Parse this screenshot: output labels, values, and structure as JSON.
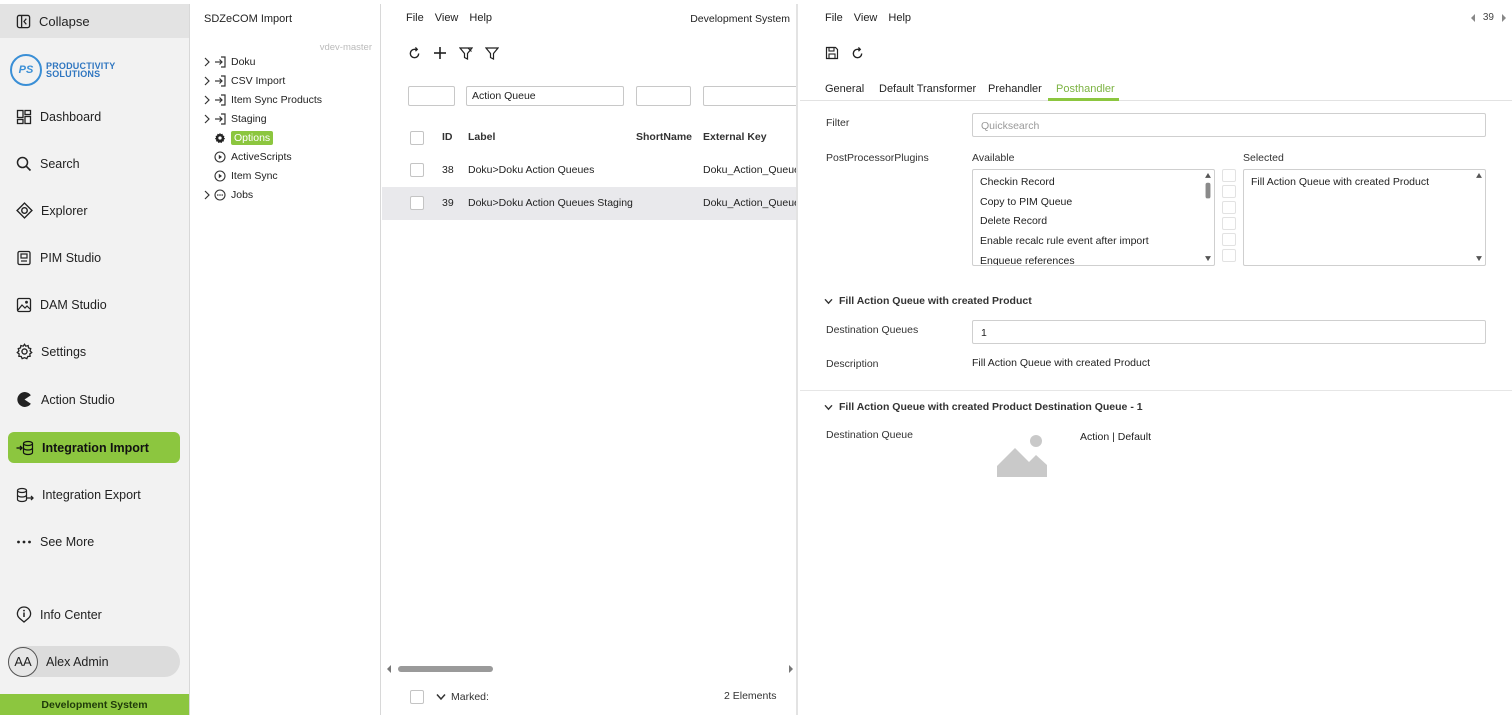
{
  "sidebar": {
    "collapse_label": "Collapse",
    "logo": {
      "initials": "PS",
      "line1": "PRODUCTIVITY",
      "line2": "SOLUTIONS"
    },
    "items": [
      {
        "label": "Dashboard",
        "icon": "dashboard-icon"
      },
      {
        "label": "Search",
        "icon": "search-icon"
      },
      {
        "label": "Explorer",
        "icon": "explorer-icon"
      },
      {
        "label": "PIM Studio",
        "icon": "pim-studio-icon"
      },
      {
        "label": "DAM Studio",
        "icon": "image-icon"
      },
      {
        "label": "Settings",
        "icon": "gear-icon"
      },
      {
        "label": "Action Studio",
        "icon": "action-studio-icon"
      },
      {
        "label": "Integration Import",
        "icon": "import-icon",
        "active": true
      },
      {
        "label": "Integration Export",
        "icon": "export-icon"
      },
      {
        "label": "See More",
        "icon": "more-icon"
      }
    ],
    "info_center_label": "Info Center",
    "user": {
      "initials": "AA",
      "name": "Alex Admin"
    },
    "system_label": "Development System",
    "accent_color": "#8cc63f"
  },
  "tree": {
    "title": "SDZeCOM Import",
    "branch": "vdev-master",
    "items": [
      {
        "label": "Doku",
        "expandable": true,
        "icon": "import-icon"
      },
      {
        "label": "CSV Import",
        "expandable": true,
        "icon": "import-icon"
      },
      {
        "label": "Item Sync Products",
        "expandable": true,
        "icon": "import-icon"
      },
      {
        "label": "Staging",
        "expandable": true,
        "icon": "import-icon"
      },
      {
        "label": "Options",
        "expandable": false,
        "icon": "gear-icon",
        "selected": true
      },
      {
        "label": "ActiveScripts",
        "expandable": false,
        "icon": "play-icon"
      },
      {
        "label": "Item Sync",
        "expandable": false,
        "icon": "play-icon"
      },
      {
        "label": "Jobs",
        "expandable": true,
        "icon": "clock-icon"
      }
    ]
  },
  "list": {
    "menu": [
      "File",
      "View",
      "Help"
    ],
    "system_label": "Development System",
    "filters": {
      "id": "",
      "label": "Action Queue",
      "shortname": "",
      "external_key": ""
    },
    "columns": [
      "ID",
      "Label",
      "ShortName",
      "External Key"
    ],
    "rows": [
      {
        "id": "38",
        "label": "Doku>Doku Action Queues",
        "shortname": "",
        "external_key": "Doku_Action_Queues"
      },
      {
        "id": "39",
        "label": "Doku>Doku Action Queues Staging",
        "shortname": "",
        "external_key": "Doku_Action_Queues",
        "selected": true
      }
    ],
    "footer": {
      "marked_label": "Marked:",
      "count": "2 Elements"
    }
  },
  "detail": {
    "menu": [
      "File",
      "View",
      "Help"
    ],
    "record_number": "39",
    "tabs": [
      {
        "label": "General"
      },
      {
        "label": "Default Transformer"
      },
      {
        "label": "Prehandler"
      },
      {
        "label": "Posthandler",
        "active": true
      }
    ],
    "filter": {
      "label": "Filter",
      "placeholder": "Quicksearch"
    },
    "plugins": {
      "label": "PostProcessorPlugins",
      "available_label": "Available",
      "selected_label": "Selected",
      "available": [
        "Checkin Record",
        "Copy to PIM Queue",
        "Delete Record",
        "Enable recalc rule event after import",
        "Enqueue references"
      ],
      "selected": [
        "Fill Action Queue with created Product"
      ]
    },
    "section1": {
      "title": "Fill Action Queue with created Product",
      "destination_queues_label": "Destination Queues",
      "destination_queues_value": "1",
      "description_label": "Description",
      "description_value": "Fill Action Queue with created Product"
    },
    "section2": {
      "title": "Fill Action Queue with created Product Destination Queue - 1",
      "destination_queue_label": "Destination Queue",
      "destination_queue_value": "Action | Default"
    }
  }
}
